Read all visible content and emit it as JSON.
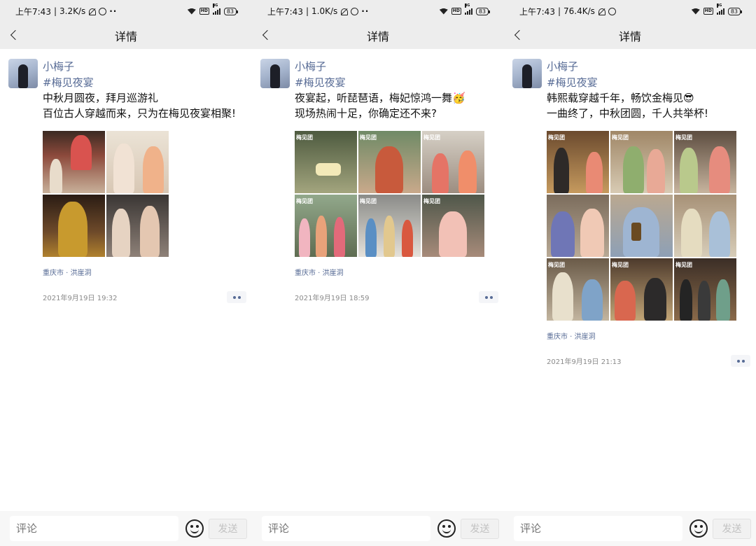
{
  "screens": [
    {
      "status": {
        "time": "上午7:43",
        "speed": "3.2K/s",
        "battery": "83",
        "network": "4G"
      },
      "nav_title": "详情",
      "post": {
        "author": "小梅子",
        "hashtag": "#梅见夜宴",
        "lines": [
          "中秋月圆夜，拜月巡游礼",
          "百位古人穿越而来，只为在梅见夜宴相聚!"
        ],
        "photo_count": 4,
        "location": "重庆市 · 洪崖洞",
        "time": "2021年9月19日 19:32"
      },
      "comment_placeholder": "评论",
      "send_label": "发送"
    },
    {
      "status": {
        "time": "上午7:43",
        "speed": "1.0K/s",
        "battery": "83",
        "network": "4G"
      },
      "nav_title": "详情",
      "post": {
        "author": "小梅子",
        "hashtag": "#梅见夜宴",
        "lines": [
          "夜宴起，听琵琶语，梅妃惊鸿一舞🥳",
          "现场热闹十足，你确定还不来?"
        ],
        "photo_count": 6,
        "location": "重庆市 · 洪崖洞",
        "time": "2021年9月19日 18:59"
      },
      "comment_placeholder": "评论",
      "send_label": "发送"
    },
    {
      "status": {
        "time": "上午7:43",
        "speed": "76.4K/s",
        "battery": "83",
        "network": "4G"
      },
      "nav_title": "详情",
      "post": {
        "author": "小梅子",
        "hashtag": "#梅见夜宴",
        "lines": [
          "韩熙载穿越千年，畅饮金梅见😎",
          "一曲终了，中秋团圆，千人共举杯!"
        ],
        "photo_count": 9,
        "location": "重庆市 · 洪崖洞",
        "time": "2021年9月19日 21:13"
      },
      "comment_placeholder": "评论",
      "send_label": "发送"
    }
  ],
  "photo_watermark": "梅见团",
  "colors": {
    "link": "#576b95",
    "header_bg": "#ededed",
    "bottom_bg": "#f7f7f7"
  }
}
